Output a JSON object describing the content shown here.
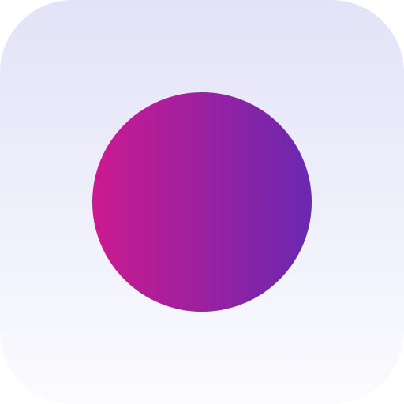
{
  "app_icon": {
    "name": "record-icon",
    "background": {
      "top_color": "#e3e3f8",
      "bottom_color": "#fbfbff"
    },
    "mark": {
      "shape": "circle",
      "left_color": "#cc1a8f",
      "right_color": "#6a28b0"
    }
  }
}
